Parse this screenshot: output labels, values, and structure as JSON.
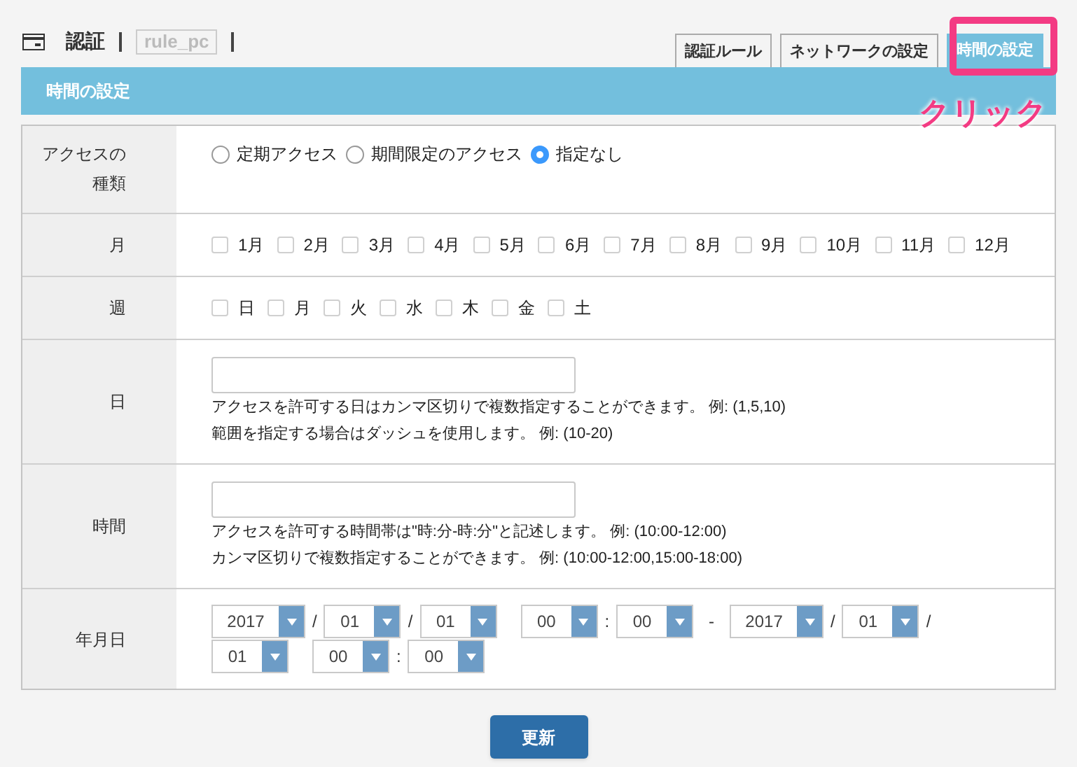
{
  "header": {
    "title": "認証",
    "rule_name": "rule_pc"
  },
  "tabs": [
    {
      "label": "認証ルール",
      "selected": false
    },
    {
      "label": "ネットワークの設定",
      "selected": false
    },
    {
      "label": "時間の設定",
      "selected": true
    }
  ],
  "annotation": {
    "label": "クリック"
  },
  "section": {
    "title": "時間の設定"
  },
  "access_type": {
    "label_lines": [
      "アクセスの",
      "種類"
    ],
    "options": [
      {
        "label": "定期アクセス",
        "selected": false
      },
      {
        "label": "期間限定のアクセス",
        "selected": false
      },
      {
        "label": "指定なし",
        "selected": true
      }
    ]
  },
  "months": {
    "label": "月",
    "items": [
      {
        "label": "1月",
        "checked": false
      },
      {
        "label": "2月",
        "checked": false
      },
      {
        "label": "3月",
        "checked": false
      },
      {
        "label": "4月",
        "checked": false
      },
      {
        "label": "5月",
        "checked": false
      },
      {
        "label": "6月",
        "checked": false
      },
      {
        "label": "7月",
        "checked": false
      },
      {
        "label": "8月",
        "checked": false
      },
      {
        "label": "9月",
        "checked": false
      },
      {
        "label": "10月",
        "checked": false
      },
      {
        "label": "11月",
        "checked": false
      },
      {
        "label": "12月",
        "checked": false
      }
    ]
  },
  "weekdays": {
    "label": "週",
    "items": [
      {
        "label": "日",
        "checked": false
      },
      {
        "label": "月",
        "checked": false
      },
      {
        "label": "火",
        "checked": false
      },
      {
        "label": "水",
        "checked": false
      },
      {
        "label": "木",
        "checked": false
      },
      {
        "label": "金",
        "checked": false
      },
      {
        "label": "土",
        "checked": false
      }
    ]
  },
  "day": {
    "label": "日",
    "help": [
      "アクセスを許可する日はカンマ区切りで複数指定することができます。 例: (1,5,10)",
      "範囲を指定する場合はダッシュを使用します。 例: (10-20)"
    ]
  },
  "time": {
    "label": "時間",
    "help": [
      "アクセスを許可する時間帯は\"時:分-時:分\"と記述します。 例: (10:00-12:00)",
      "カンマ区切りで複数指定することができます。 例: (10:00-12:00,15:00-18:00)"
    ]
  },
  "date": {
    "label": "年月日",
    "items": [
      {
        "kind": "select",
        "value": "2017"
      },
      {
        "kind": "sep",
        "text": "/"
      },
      {
        "kind": "select",
        "value": "01"
      },
      {
        "kind": "sep",
        "text": "/"
      },
      {
        "kind": "select",
        "value": "01"
      },
      {
        "kind": "select",
        "value": "00"
      },
      {
        "kind": "sep",
        "text": ":"
      },
      {
        "kind": "select",
        "value": "00"
      },
      {
        "kind": "dash",
        "text": "-"
      },
      {
        "kind": "select",
        "value": "2017"
      },
      {
        "kind": "sep",
        "text": "/"
      },
      {
        "kind": "select",
        "value": "01"
      },
      {
        "kind": "sep",
        "text": "/"
      },
      {
        "kind": "select",
        "value": "01"
      },
      {
        "kind": "select",
        "value": "00"
      },
      {
        "kind": "sep",
        "text": ":"
      },
      {
        "kind": "select",
        "value": "00"
      }
    ]
  },
  "submit": {
    "label": "更新"
  }
}
